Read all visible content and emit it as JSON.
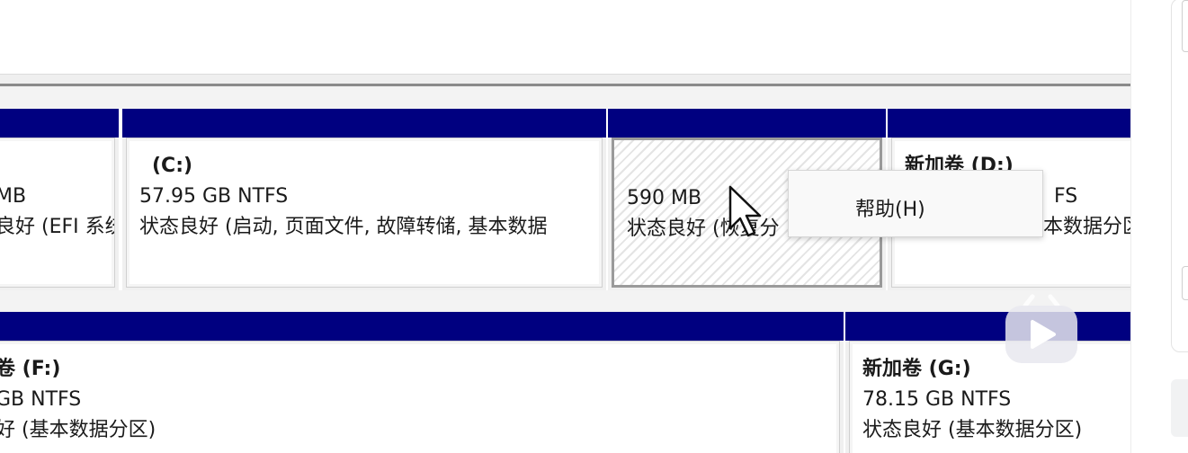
{
  "partitions": [
    {
      "id": "efi",
      "name": "",
      "size": "MB",
      "status": "良好 (EFI 系统"
    },
    {
      "id": "c",
      "name": "(C:)",
      "size": "57.95 GB NTFS",
      "status": "状态良好 (启动, 页面文件, 故障转储, 基本数据"
    },
    {
      "id": "recovery",
      "name": "",
      "size": "590 MB",
      "status": "状态良好 (恢复分"
    },
    {
      "id": "d",
      "name": "新加卷 (D:)",
      "size": "FS",
      "status": "本数据分区"
    },
    {
      "id": "f",
      "name": "卷 (F:)",
      "size": "GB NTFS",
      "status": "好 (基本数据分区)"
    },
    {
      "id": "g",
      "name": "新加卷 (G:)",
      "size": "78.15 GB NTFS",
      "status": "状态良好 (基本数据分区)"
    }
  ],
  "context_menu": {
    "items": [
      "帮助(H)"
    ]
  },
  "colors": {
    "partition_bar": "#000080",
    "panel_bg": "#f0f0f0"
  },
  "icons": {
    "cursor": "arrow-cursor-icon",
    "overlay": "bilibili-tv-icon"
  }
}
